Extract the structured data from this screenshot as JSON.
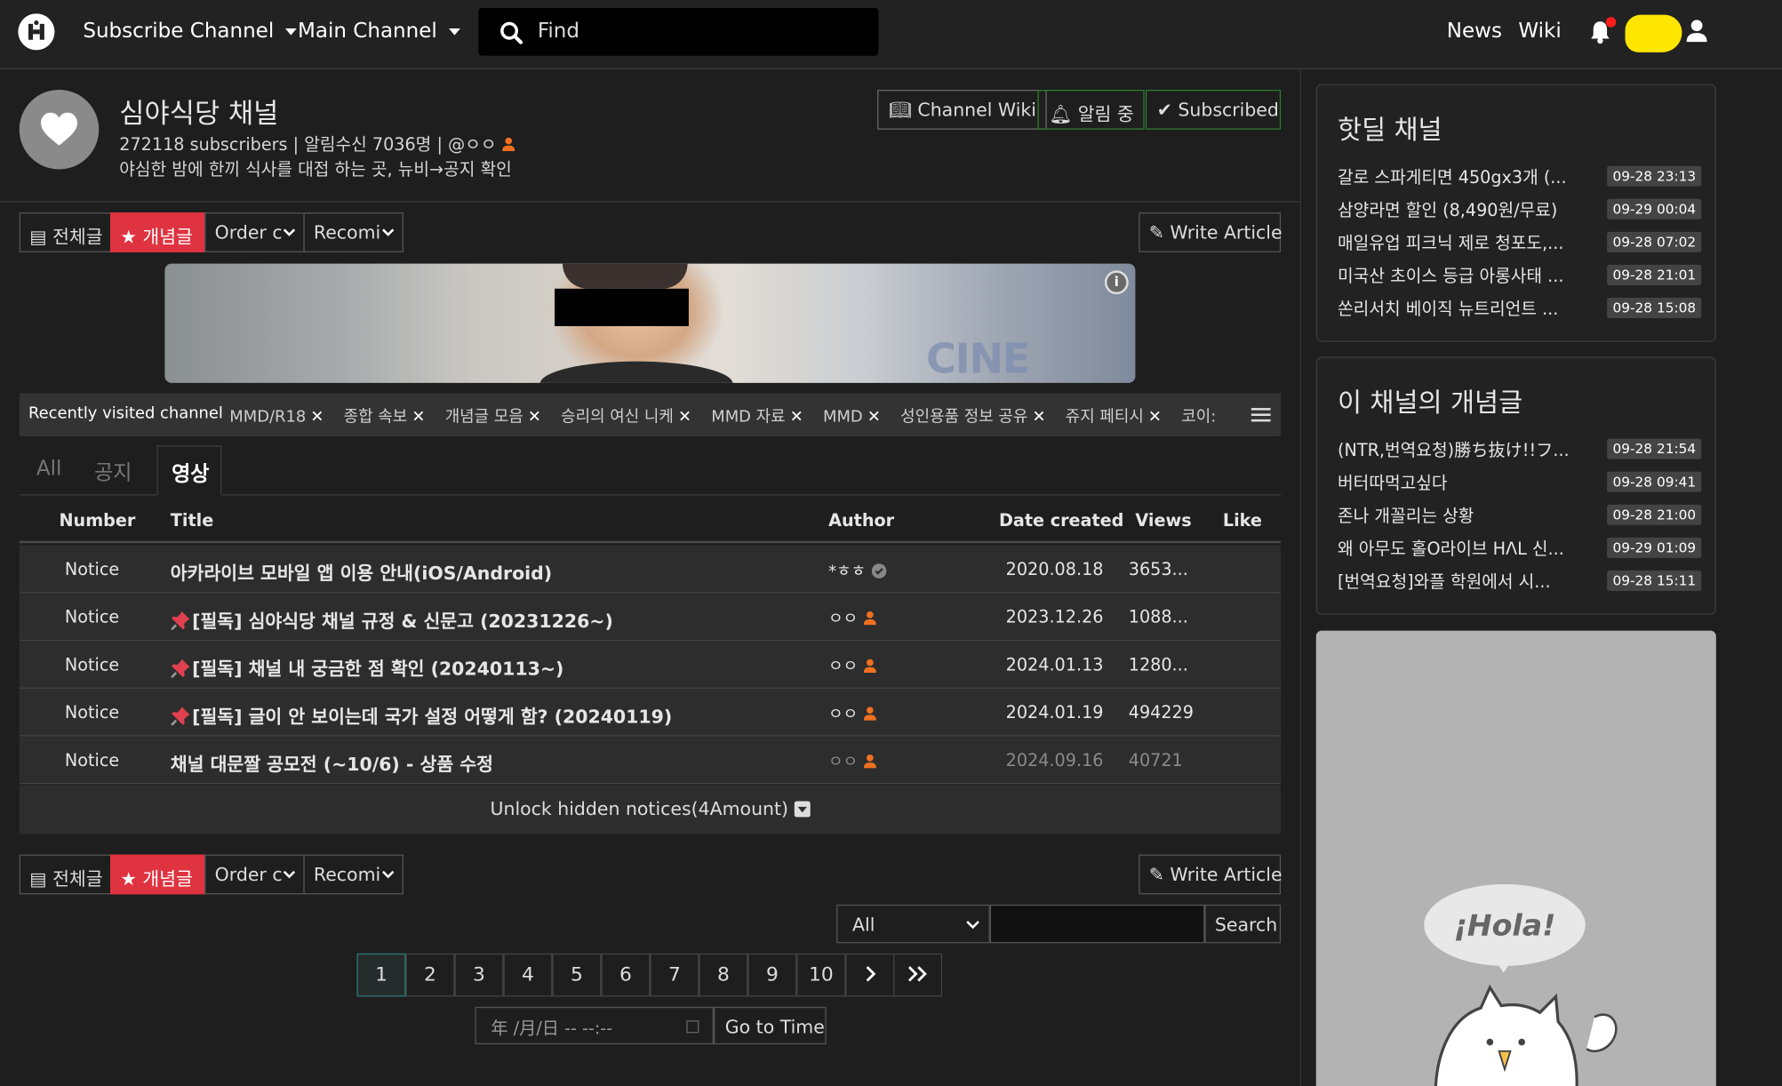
{
  "nav": {
    "subscribe_channel": "Subscribe Channel",
    "main_channel": "Main Channel",
    "search_placeholder": "Find",
    "news": "News",
    "wiki": "Wiki"
  },
  "channel": {
    "name": "심야식당 채널",
    "subscribers": "272118 subscribers",
    "notify_count": "알림수신 7036명",
    "handle": "@ㅇㅇ",
    "description": "야심한 밤에 한끼 식사를 대접 하는 곳, 뉴비→공지 확인",
    "buttons": {
      "wiki": "Channel Wiki",
      "notify": "알림 중",
      "subscribed": "Subscribed"
    }
  },
  "toolbar": {
    "all_posts": "전체글",
    "best_posts": "개념글",
    "order": "Order c",
    "recommend": "Recomi",
    "write": "Write Article"
  },
  "banner": {
    "logo_text": "CINE BLUE"
  },
  "recent": {
    "label": "Recently visited channel",
    "items": [
      "MMD/R18",
      "종합 속보",
      "개념글 모음",
      "승리의 여신 니케",
      "MMD 자료",
      "MMD",
      "성인용품 정보 공유",
      "쥬지 페티시",
      "코이:"
    ]
  },
  "tabs": [
    "All",
    "공지",
    "영상"
  ],
  "table": {
    "headers": {
      "number": "Number",
      "title": "Title",
      "author": "Author",
      "date": "Date created",
      "views": "Views",
      "like": "Like"
    },
    "rows": [
      {
        "number": "Notice",
        "title": "아카라이브 모바일 앱 이용 안내(iOS/Android)",
        "author": "*ㅎㅎ",
        "date": "2020.08.18",
        "views": "3653..."
      },
      {
        "number": "Notice",
        "title": "[필독] 심야식당 채널 규정 & 신문고 (20231226~)",
        "author": "ㅇㅇ",
        "date": "2023.12.26",
        "views": "1088..."
      },
      {
        "number": "Notice",
        "title": "[필독] 채널 내 궁금한 점 확인 (20240113~)",
        "author": "ㅇㅇ",
        "date": "2024.01.13",
        "views": "1280..."
      },
      {
        "number": "Notice",
        "title": "[필독] 글이 안 보이는데 국가 설정 어떻게 함? (20240119)",
        "author": "ㅇㅇ",
        "date": "2024.01.19",
        "views": "494229"
      },
      {
        "number": "Notice",
        "title": "채널 대문짤 공모전 (~10/6) - 상품 수정",
        "author": "ㅇㅇ",
        "date": "2024.09.16",
        "views": "40721"
      }
    ],
    "unlock": "Unlock hidden notices(4Amount)"
  },
  "search": {
    "scope": "All",
    "button": "Search"
  },
  "pagination": [
    "1",
    "2",
    "3",
    "4",
    "5",
    "6",
    "7",
    "8",
    "9",
    "10"
  ],
  "datetime": {
    "placeholder": "年 /月/日 -- --:--",
    "button": "Go to Time"
  },
  "hot_deals": {
    "title": "핫딜 채널",
    "items": [
      {
        "title": "갈로 스파게티면 450gx3개 (...",
        "time": "09-28 23:13"
      },
      {
        "title": "삼양라면 할인 (8,490원/무료)",
        "time": "09-29 00:04"
      },
      {
        "title": "매일유업 피크닉 제로 청포도,...",
        "time": "09-28 07:02"
      },
      {
        "title": "미국산 초이스 등급 아롱사태 ...",
        "time": "09-28 21:01"
      },
      {
        "title": "쏜리서치 베이직 뉴트리언트 ...",
        "time": "09-28 15:08"
      }
    ]
  },
  "best_in_channel": {
    "title": "이 채널의 개념글",
    "items": [
      {
        "title": "(NTR,번역요청)勝ち抜け!!フ...",
        "time": "09-28 21:54"
      },
      {
        "title": "버터따먹고싶다",
        "time": "09-28 09:41"
      },
      {
        "title": "존나 개꼴리는 상황",
        "time": "09-28 21:00"
      },
      {
        "title": "왜 아무도 홀O라이브 HΛL 신...",
        "time": "09-29 01:09"
      },
      {
        "title": "[번역요청]와플 학원에서 시...",
        "time": "09-28 15:11"
      }
    ]
  },
  "ad": {
    "text": "¡Hola!"
  },
  "colors": {
    "accent_red": "#e03341",
    "bg": "#1e1e1e",
    "green_border": "#2e7d32",
    "page_current": "#2b7a74",
    "blob": "#ffe600"
  }
}
